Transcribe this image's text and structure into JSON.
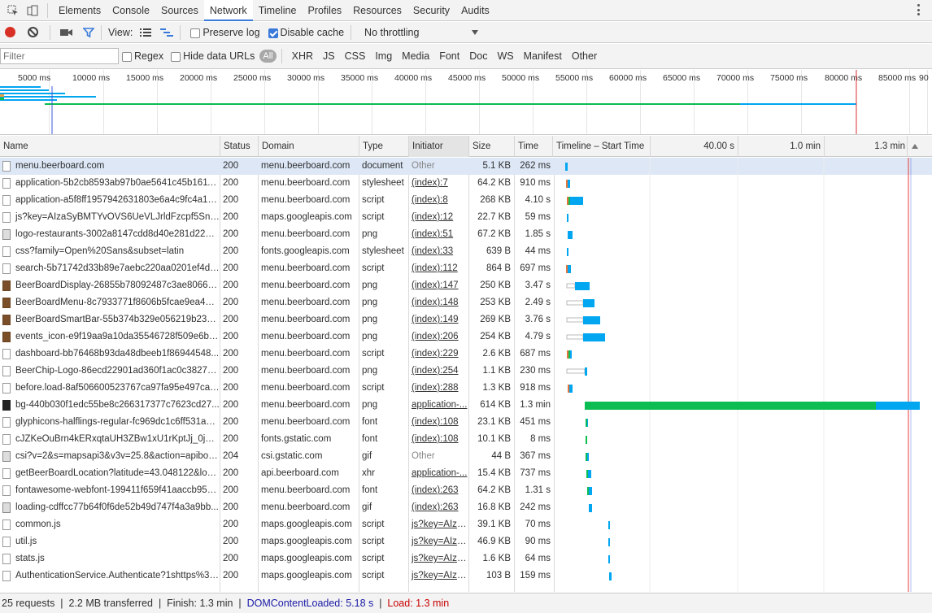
{
  "tabs": [
    "Elements",
    "Console",
    "Sources",
    "Network",
    "Timeline",
    "Profiles",
    "Resources",
    "Security",
    "Audits"
  ],
  "active_tab": "Network",
  "toolbar": {
    "view_label": "View:",
    "preserve_log": "Preserve log",
    "disable_cache": "Disable cache",
    "throttling": "No throttling"
  },
  "filterbar": {
    "filter_placeholder": "Filter",
    "regex": "Regex",
    "hide_data_urls": "Hide data URLs",
    "all": "All",
    "types": [
      "XHR",
      "JS",
      "CSS",
      "Img",
      "Media",
      "Font",
      "Doc",
      "WS",
      "Manifest",
      "Other"
    ]
  },
  "overview_ticks": [
    "5000 ms",
    "10000 ms",
    "15000 ms",
    "20000 ms",
    "25000 ms",
    "30000 ms",
    "35000 ms",
    "40000 ms",
    "45000 ms",
    "50000 ms",
    "55000 ms",
    "60000 ms",
    "65000 ms",
    "70000 ms",
    "75000 ms",
    "80000 ms",
    "85000 ms",
    "90"
  ],
  "columns": {
    "name": "Name",
    "status": "Status",
    "domain": "Domain",
    "type": "Type",
    "initiator": "Initiator",
    "size": "Size",
    "time": "Time",
    "timeline": "Timeline – Start Time",
    "t1": "40.00 s",
    "t2": "1.0 min",
    "t3": "1.3 min"
  },
  "rows": [
    {
      "name": "menu.beerboard.com",
      "status": "200",
      "domain": "menu.beerboard.com",
      "type": "document",
      "initiator": "Other",
      "init_link": false,
      "size": "5.1 KB",
      "time": "262 ms",
      "icon": "doc"
    },
    {
      "name": "application-5b2cb8593ab97b0ae5641c45b16119...",
      "status": "200",
      "domain": "menu.beerboard.com",
      "type": "stylesheet",
      "initiator": "(index):7",
      "init_link": true,
      "size": "64.2 KB",
      "time": "910 ms",
      "icon": "doc"
    },
    {
      "name": "application-a5f8ff1957942631803e6a4c9fc4a13...",
      "status": "200",
      "domain": "menu.beerboard.com",
      "type": "script",
      "initiator": "(index):8",
      "init_link": true,
      "size": "268 KB",
      "time": "4.10 s",
      "icon": "doc"
    },
    {
      "name": "js?key=AIzaSyBMTYvOVS6UeVLJrldFzcpf5Sn6Sh...",
      "status": "200",
      "domain": "maps.googleapis.com",
      "type": "script",
      "initiator": "(index):12",
      "init_link": true,
      "size": "22.7 KB",
      "time": "59 ms",
      "icon": "doc"
    },
    {
      "name": "logo-restaurants-3002a8147cdd8d40e281d22a0...",
      "status": "200",
      "domain": "menu.beerboard.com",
      "type": "png",
      "initiator": "(index):51",
      "init_link": true,
      "size": "67.2 KB",
      "time": "1.85 s",
      "icon": "pic"
    },
    {
      "name": "css?family=Open%20Sans&subset=latin",
      "status": "200",
      "domain": "fonts.googleapis.com",
      "type": "stylesheet",
      "initiator": "(index):33",
      "init_link": true,
      "size": "639 B",
      "time": "44 ms",
      "icon": "doc"
    },
    {
      "name": "search-5b71742d33b89e7aebc220aa0201ef4d9...",
      "status": "200",
      "domain": "menu.beerboard.com",
      "type": "script",
      "initiator": "(index):112",
      "init_link": true,
      "size": "864 B",
      "time": "697 ms",
      "icon": "doc"
    },
    {
      "name": "BeerBoardDisplay-26855b78092487c3ae80665...",
      "status": "200",
      "domain": "menu.beerboard.com",
      "type": "png",
      "initiator": "(index):147",
      "init_link": true,
      "size": "250 KB",
      "time": "3.47 s",
      "icon": "img"
    },
    {
      "name": "BeerBoardMenu-8c7933771f8606b5fcae9ea407...",
      "status": "200",
      "domain": "menu.beerboard.com",
      "type": "png",
      "initiator": "(index):148",
      "init_link": true,
      "size": "253 KB",
      "time": "2.49 s",
      "icon": "img"
    },
    {
      "name": "BeerBoardSmartBar-55b374b329e056219b234d...",
      "status": "200",
      "domain": "menu.beerboard.com",
      "type": "png",
      "initiator": "(index):149",
      "init_link": true,
      "size": "269 KB",
      "time": "3.76 s",
      "icon": "img"
    },
    {
      "name": "events_icon-e9f19aa9a10da35546728f509e6b9...",
      "status": "200",
      "domain": "menu.beerboard.com",
      "type": "png",
      "initiator": "(index):206",
      "init_link": true,
      "size": "254 KB",
      "time": "4.79 s",
      "icon": "img"
    },
    {
      "name": "dashboard-bb76468b93da48dbeeb1f86944548...",
      "status": "200",
      "domain": "menu.beerboard.com",
      "type": "script",
      "initiator": "(index):229",
      "init_link": true,
      "size": "2.6 KB",
      "time": "687 ms",
      "icon": "doc"
    },
    {
      "name": "BeerChip-Logo-86ecd22901ad360f1ac0c3827b3...",
      "status": "200",
      "domain": "menu.beerboard.com",
      "type": "png",
      "initiator": "(index):254",
      "init_link": true,
      "size": "1.1 KB",
      "time": "230 ms",
      "icon": "doc"
    },
    {
      "name": "before.load-8af506600523767ca97fa95e497ca4...",
      "status": "200",
      "domain": "menu.beerboard.com",
      "type": "script",
      "initiator": "(index):288",
      "init_link": true,
      "size": "1.3 KB",
      "time": "918 ms",
      "icon": "doc"
    },
    {
      "name": "bg-440b030f1edc55be8c266317377c7623cd27...",
      "status": "200",
      "domain": "menu.beerboard.com",
      "type": "png",
      "initiator": "application-...",
      "init_link": true,
      "size": "614 KB",
      "time": "1.3 min",
      "icon": "dark"
    },
    {
      "name": "glyphicons-halflings-regular-fc969dc1c6ff531abc...",
      "status": "200",
      "domain": "menu.beerboard.com",
      "type": "font",
      "initiator": "(index):108",
      "init_link": true,
      "size": "23.1 KB",
      "time": "451 ms",
      "icon": "doc"
    },
    {
      "name": "cJZKeOuBrn4kERxqtaUH3ZBw1xU1rKptJj_0jans9...",
      "status": "200",
      "domain": "fonts.gstatic.com",
      "type": "font",
      "initiator": "(index):108",
      "init_link": true,
      "size": "10.1 KB",
      "time": "8 ms",
      "icon": "doc"
    },
    {
      "name": "csi?v=2&s=mapsapi3&v3v=25.8&action=apiboot...",
      "status": "204",
      "domain": "csi.gstatic.com",
      "type": "gif",
      "initiator": "Other",
      "init_link": false,
      "size": "44 B",
      "time": "367 ms",
      "icon": "pic"
    },
    {
      "name": "getBeerBoardLocation?latitude=43.048122&longi...",
      "status": "200",
      "domain": "api.beerboard.com",
      "type": "xhr",
      "initiator": "application-...",
      "init_link": true,
      "size": "15.4 KB",
      "time": "737 ms",
      "icon": "doc"
    },
    {
      "name": "fontawesome-webfont-199411f659f41aaccb959b...",
      "status": "200",
      "domain": "menu.beerboard.com",
      "type": "font",
      "initiator": "(index):263",
      "init_link": true,
      "size": "64.2 KB",
      "time": "1.31 s",
      "icon": "doc"
    },
    {
      "name": "loading-cdffcc77b64f0f6de52b49d747f4a3a9bb...",
      "status": "200",
      "domain": "menu.beerboard.com",
      "type": "gif",
      "initiator": "(index):263",
      "init_link": true,
      "size": "16.8 KB",
      "time": "242 ms",
      "icon": "pic"
    },
    {
      "name": "common.js",
      "status": "200",
      "domain": "maps.googleapis.com",
      "type": "script",
      "initiator": "js?key=AIza...",
      "init_link": true,
      "size": "39.1 KB",
      "time": "70 ms",
      "icon": "doc"
    },
    {
      "name": "util.js",
      "status": "200",
      "domain": "maps.googleapis.com",
      "type": "script",
      "initiator": "js?key=AIza...",
      "init_link": true,
      "size": "46.9 KB",
      "time": "90 ms",
      "icon": "doc"
    },
    {
      "name": "stats.js",
      "status": "200",
      "domain": "maps.googleapis.com",
      "type": "script",
      "initiator": "js?key=AIza...",
      "init_link": true,
      "size": "1.6 KB",
      "time": "64 ms",
      "icon": "doc"
    },
    {
      "name": "AuthenticationService.Authenticate?1shttps%3A%...",
      "status": "200",
      "domain": "maps.googleapis.com",
      "type": "script",
      "initiator": "js?key=AIza...",
      "init_link": true,
      "size": "103 B",
      "time": "159 ms",
      "icon": "doc"
    }
  ],
  "status": {
    "requests": "25 requests",
    "transferred": "2.2 MB transferred",
    "finish": "Finish: 1.3 min",
    "dcl": "DOMContentLoaded: 5.18 s",
    "load": "Load: 1.3 min"
  },
  "colors": {
    "waiting": "#00a6f0",
    "content": "#0bbd52",
    "queue": "#ffffff",
    "load_line": "#e43b3b",
    "dcl_line": "#3b5bdb"
  }
}
